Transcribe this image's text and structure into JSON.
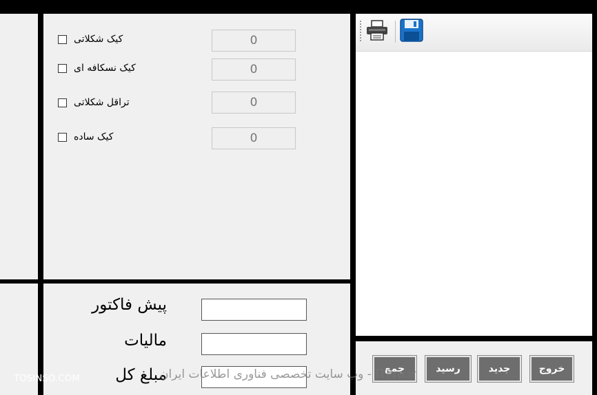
{
  "products": [
    {
      "label": "کیک شکلاتی",
      "qty": "0"
    },
    {
      "label": "کیک نسکافه ای",
      "qty": "0"
    },
    {
      "label": "تراقل شکلاتی",
      "qty": "0"
    },
    {
      "label": "کیک ساده",
      "qty": "0"
    }
  ],
  "summary": {
    "subtotal_label": "پیش فاکتور",
    "tax_label": "مالیات",
    "total_label": "مبلغ کل",
    "subtotal_value": "",
    "tax_value": "",
    "total_value": ""
  },
  "toolbar": {
    "print_icon": "printer-icon",
    "save_icon": "floppy-disk-icon"
  },
  "actions": {
    "exit": "خروج",
    "new": "جدید",
    "receipt": "رسید",
    "calc": "جمع"
  },
  "watermark": {
    "site_left": "TOSINSO.COM",
    "site_center": "ITPro.ir - وب سایت تخصصی فناوری اطلاعات ایران"
  },
  "colors": {
    "button_bg": "#6e6e6e",
    "panel_bg": "#f0f0f0",
    "frame": "#000000"
  }
}
